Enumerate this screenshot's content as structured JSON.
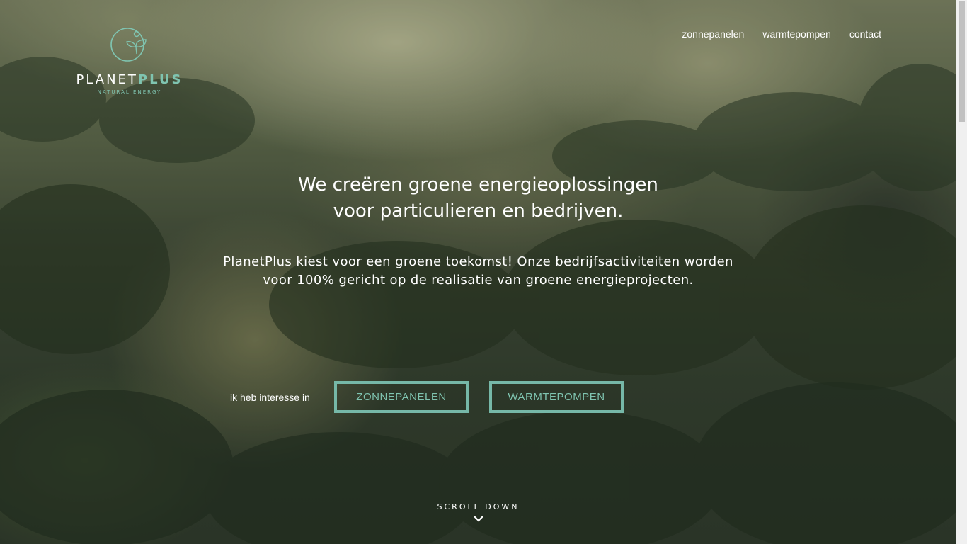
{
  "brand": {
    "name_part1": "PLANET",
    "name_part2": "PLUS",
    "tagline": "NATURAL ENERGY",
    "accent_color": "#7fc4b0"
  },
  "nav": {
    "items": [
      {
        "label": "zonnepanelen"
      },
      {
        "label": "warmtepompen"
      },
      {
        "label": "contact"
      }
    ]
  },
  "hero": {
    "title_line1": "We creëren groene energieoplossingen",
    "title_line2": "voor particulieren en bedrijven.",
    "subtitle_line1": "PlanetPlus kiest voor een groene toekomst! Onze bedrijfsactiviteiten worden",
    "subtitle_line2": "voor 100% gericht op de realisatie van groene energieprojecten."
  },
  "interest": {
    "label": "ik heb interesse in",
    "buttons": [
      {
        "label": "ZONNEPANELEN"
      },
      {
        "label": "WARMTEPOMPEN"
      }
    ]
  },
  "scroll": {
    "label": "SCROLL DOWN",
    "icon": "chevron-down-icon"
  }
}
